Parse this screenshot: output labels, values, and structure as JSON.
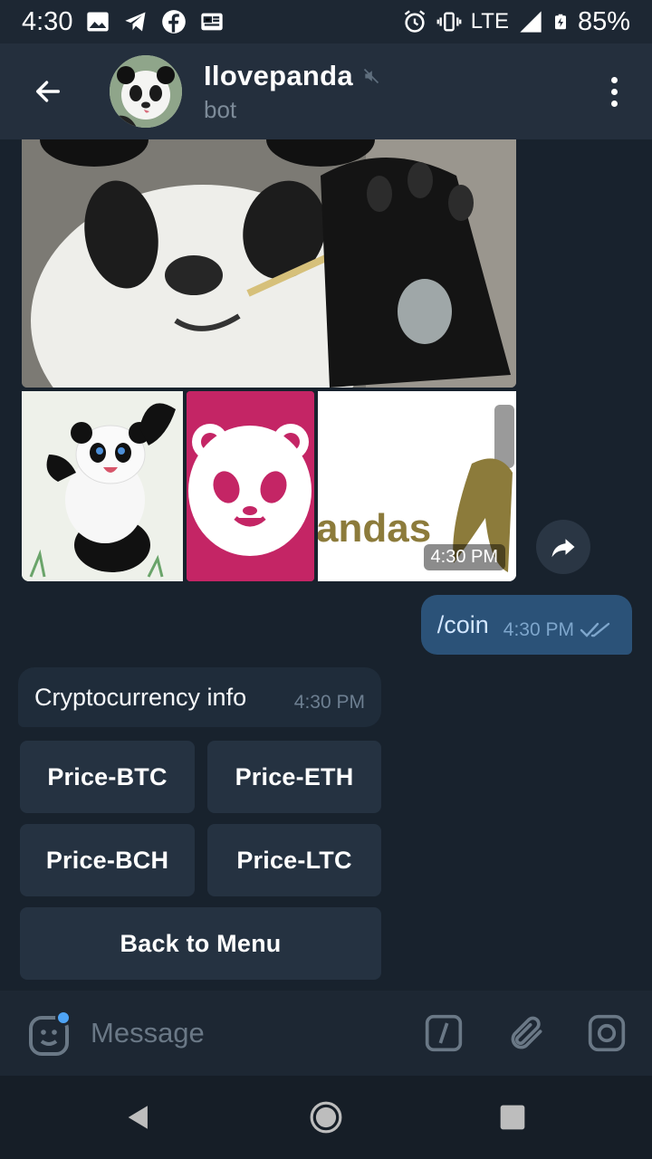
{
  "status_bar": {
    "time": "4:30",
    "network": "LTE",
    "battery": "85%",
    "icons": [
      "image-icon",
      "telegram-icon",
      "facebook-icon",
      "news-icon",
      "alarm-icon",
      "vibrate-icon",
      "signal-icon",
      "battery-icon"
    ]
  },
  "header": {
    "title": "Ilovepanda",
    "subtitle": "bot",
    "muted_icon": "mute-icon"
  },
  "album": {
    "time": "4:30 PM",
    "partial_caption": "andas"
  },
  "messages": {
    "outgoing": {
      "text": "/coin",
      "time": "4:30 PM",
      "status": "read"
    },
    "incoming": {
      "text": "Cryptocurrency info",
      "time": "4:30 PM"
    }
  },
  "keyboard": {
    "btn_btc": "Price-BTC",
    "btn_eth": "Price-ETH",
    "btn_bch": "Price-BCH",
    "btn_ltc": "Price-LTC",
    "btn_menu": "Back to Menu"
  },
  "input": {
    "placeholder": "Message"
  },
  "colors": {
    "background": "#18222d",
    "header": "#242f3d",
    "outgoing_bubble": "#2b5278",
    "incoming_bubble": "#1f2c3a",
    "keyboard_button": "#253241",
    "accent": "#4ea4f6"
  }
}
